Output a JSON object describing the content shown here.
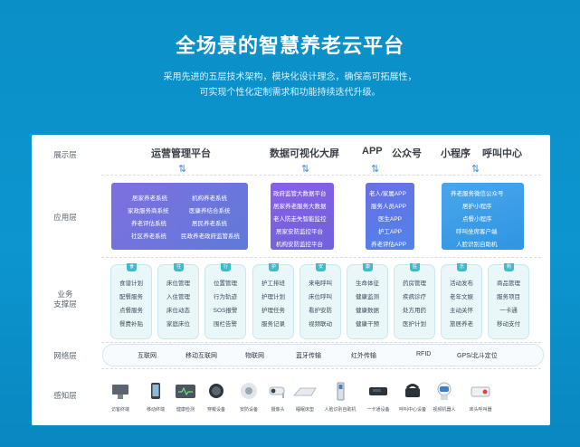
{
  "header": {
    "title": "全场景的智慧养老云平台",
    "subtitle_line1": "采用先进的五层技术架构，模块化设计理念，确保高可拓展性，",
    "subtitle_line2": "可实现个性化定制需求和功能持续迭代升级。"
  },
  "rows": {
    "display": "展示层",
    "app": "应用层",
    "biz1": "业务",
    "biz2": "支撑层",
    "network": "网络层",
    "sensing": "感知层"
  },
  "display_items": [
    "运营管理平台",
    "数据可视化大屏",
    "APP",
    "公众号",
    "小程序",
    "呼叫中心"
  ],
  "apps": {
    "box1": [
      "居家养老系统",
      "机构养老系统",
      "家政服务商系统",
      "医康养结合系统",
      "养老评估系统",
      "居民养老系统",
      "社区养老系统",
      "民政养老政府监管系统"
    ],
    "box2": [
      "政府监管大数据平台",
      "居家养老服务大数据",
      "老人防走失智能监控",
      "居家安防监控平台",
      "机构安防监控平台"
    ],
    "box3": [
      "老人/家属APP",
      "服务人员APP",
      "医生APP",
      "护工APP",
      "养老评估APP"
    ],
    "box4": [
      "养老服务微信公众号",
      "居护小程序",
      "点餐小程序",
      "呼叫坐席客户端",
      "人脸识别自助机"
    ]
  },
  "biz_columns": [
    {
      "cap": "食",
      "items": [
        "食谱计划",
        "配餐服务",
        "点餐服务",
        "餐费补贴"
      ]
    },
    {
      "cap": "住",
      "items": [
        "床位管理",
        "入住管理",
        "床位动态",
        "家庭床位"
      ]
    },
    {
      "cap": "行",
      "items": [
        "位置管理",
        "行为轨迹",
        "SOS报警",
        "围栏告警"
      ]
    },
    {
      "cap": "护",
      "items": [
        "护工排班",
        "护理计划",
        "护理任务",
        "服务记录"
      ]
    },
    {
      "cap": "安",
      "items": [
        "来电呼叫",
        "床位呼叫",
        "看护安防",
        "视频联动"
      ]
    },
    {
      "cap": "康",
      "items": [
        "生命体征",
        "健康监测",
        "健康数据",
        "健康干预"
      ]
    },
    {
      "cap": "医",
      "items": [
        "药房管理",
        "疾病诊疗",
        "处方用药",
        "医护计划"
      ]
    },
    {
      "cap": "乐",
      "items": [
        "活动发布",
        "老年文娱",
        "主动关怀",
        "旅居养老"
      ]
    },
    {
      "cap": "购",
      "items": [
        "商品管理",
        "服务项目",
        "一卡通",
        "移动支付"
      ]
    }
  ],
  "network_items": [
    "互联网",
    "移动互联网",
    "物联网",
    "蓝牙传输",
    "红外传输",
    "RFID",
    "GPS/北斗定位"
  ],
  "devices": [
    {
      "icon": "visitor-terminal-icon",
      "label": "访客终端"
    },
    {
      "icon": "mobile-terminal-icon",
      "label": "移动终端"
    },
    {
      "icon": "health-monitor-icon",
      "label": "健康检测"
    },
    {
      "icon": "wearable-icon",
      "label": "穿戴设备"
    },
    {
      "icon": "security-device-icon",
      "label": "安防设备"
    },
    {
      "icon": "camera-icon",
      "label": "摄像头"
    },
    {
      "icon": "sleep-pad-icon",
      "label": "睡眠床垫"
    },
    {
      "icon": "face-kiosk-icon",
      "label": "人脸识别自助机"
    },
    {
      "icon": "card-reader-icon",
      "label": "一卡通设备"
    },
    {
      "icon": "call-device-icon",
      "label": "呼叫中心设备"
    },
    {
      "icon": "video-robot-icon",
      "label": "视频机器人"
    },
    {
      "icon": "bed-alarm-icon",
      "label": "床头呼叫器"
    }
  ],
  "colors": {
    "background": "#0b8fc7",
    "app_box1": "#6f72d6",
    "app_box2": "#7a5fe0",
    "app_box3": "#5a7fe8",
    "app_box4": "#3aa3e6",
    "biz_cap": "#3fbcc7"
  }
}
